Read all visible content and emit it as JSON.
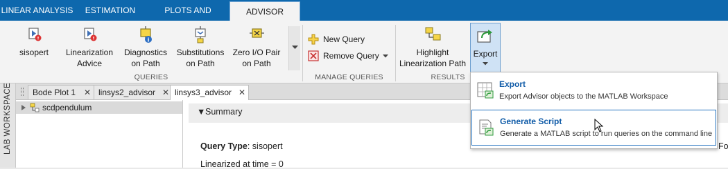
{
  "tabs": {
    "linear_analysis": "LINEAR ANALYSIS",
    "estimation": "ESTIMATION",
    "plots_results": "PLOTS AND RESULTS",
    "advisor": "ADVISOR"
  },
  "queries": {
    "sisopert": "sisopert",
    "lin_advice_1": "Linearization",
    "lin_advice_2": "Advice",
    "diag_1": "Diagnostics",
    "diag_2": "on Path",
    "subs_1": "Substitutions",
    "subs_2": "on Path",
    "zero_1": "Zero I/O Pair",
    "zero_2": "on Path",
    "section_label": "QUERIES"
  },
  "manage": {
    "new_query": "New Query",
    "remove_query": "Remove Query",
    "section_label": "MANAGE QUERIES"
  },
  "results": {
    "highlight_1": "Highlight",
    "highlight_2": "Linearization Path",
    "export": "Export",
    "section_label": "RESULTS"
  },
  "sidebar": {
    "workspace_label": "LAB WORKSPACE"
  },
  "doc_tabs": {
    "bode": "Bode Plot 1",
    "linsys2": "linsys2_advisor",
    "linsys3": "linsys3_advisor"
  },
  "browser": {
    "item": "scdpendulum"
  },
  "document": {
    "summary": "Summary",
    "query_type_label": "Query Type",
    "query_type_value": ": sisopert",
    "linearized": "Linearized at time = 0",
    "cut_text": "Fo"
  },
  "dropdown": {
    "export_title": "Export",
    "export_desc": "Export Advisor objects to the MATLAB Workspace",
    "gen_title": "Generate Script",
    "gen_desc": "Generate a MATLAB script to run queries on the command line"
  },
  "colors": {
    "tab_strip": "#0e68ad",
    "accent_link": "#0e5aa7",
    "selection_border": "#1f6fbd"
  }
}
